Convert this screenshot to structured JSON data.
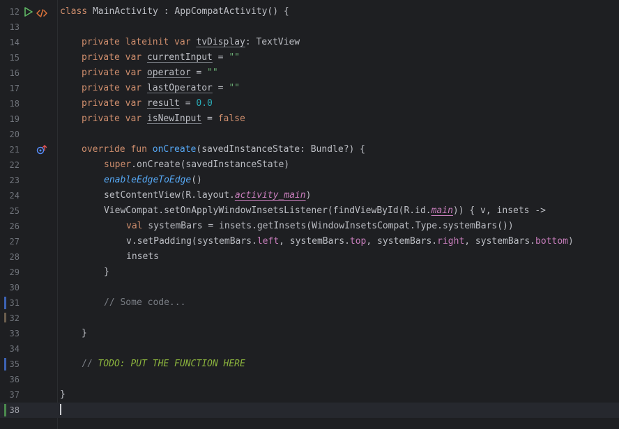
{
  "editor": {
    "language": "kotlin",
    "current_line": "38",
    "colors": {
      "background": "#1e1f22",
      "keyword": "#cf8e6d",
      "string": "#6aab73",
      "number": "#2aacb8",
      "function": "#56a8f5",
      "property": "#c77dbb",
      "comment": "#7a7e85",
      "todo": "#8bb33d",
      "change_marker_modified": "#3d63b4",
      "change_marker_added": "#4b8a4e"
    },
    "gutter_icons": {
      "line_12": [
        "run-icon",
        "code-icon"
      ],
      "line_21": [
        "override-icon"
      ]
    },
    "lines": [
      {
        "num": "12",
        "t": {
          "a": "class",
          "b": " MainActivity : AppCompatActivity() {"
        }
      },
      {
        "num": "13"
      },
      {
        "num": "14",
        "t": {
          "a": "private lateinit var",
          "b": "tvDisplay",
          "c": ": TextView"
        }
      },
      {
        "num": "15",
        "t": {
          "a": "private var",
          "b": "currentInput",
          "c": " = ",
          "d": "\"\""
        }
      },
      {
        "num": "16",
        "t": {
          "a": "private var",
          "b": "operator",
          "c": " = ",
          "d": "\"\""
        }
      },
      {
        "num": "17",
        "t": {
          "a": "private var",
          "b": "lastOperator",
          "c": " = ",
          "d": "\"\""
        }
      },
      {
        "num": "18",
        "t": {
          "a": "private var",
          "b": "result",
          "c": " = ",
          "d": "0.0"
        }
      },
      {
        "num": "19",
        "t": {
          "a": "private var",
          "b": "isNewInput",
          "c": " = ",
          "d": "false"
        }
      },
      {
        "num": "20"
      },
      {
        "num": "21",
        "t": {
          "a": "override fun",
          "b": "onCreate",
          "c": "(savedInstanceState: Bundle?) {"
        }
      },
      {
        "num": "22",
        "t": {
          "a": "super",
          "b": ".onCreate(savedInstanceState)"
        }
      },
      {
        "num": "23",
        "t": {
          "a": "enableEdgeToEdge",
          "b": "()"
        }
      },
      {
        "num": "24",
        "t": {
          "a": "setContentView(R.layout.",
          "b": "activity_main",
          "c": ")"
        }
      },
      {
        "num": "25",
        "t": {
          "a": "ViewCompat.setOnApplyWindowInsetsListener(findViewById(R.id.",
          "b": "main",
          "c": ")) { v, insets ->"
        }
      },
      {
        "num": "26",
        "t": {
          "a": "val",
          "b": " systemBars = insets.getInsets(WindowInsetsCompat.Type.systemBars())"
        }
      },
      {
        "num": "27",
        "t": {
          "a": "v.setPadding(systemBars.",
          "b": "left",
          "c": ", systemBars.",
          "d": "top",
          "e": ", systemBars.",
          "f": "right",
          "g": ", systemBars.",
          "h": "bottom",
          "i": ")"
        }
      },
      {
        "num": "28",
        "t": {
          "a": "insets"
        }
      },
      {
        "num": "29",
        "t": {
          "a": "}"
        }
      },
      {
        "num": "30"
      },
      {
        "num": "31",
        "t": {
          "a": "// Some code..."
        }
      },
      {
        "num": "32"
      },
      {
        "num": "33",
        "t": {
          "a": "}"
        }
      },
      {
        "num": "34"
      },
      {
        "num": "35",
        "t": {
          "a": "// ",
          "b": "TODO: PUT THE FUNCTION HERE"
        }
      },
      {
        "num": "36"
      },
      {
        "num": "37",
        "t": {
          "a": "}"
        }
      },
      {
        "num": "38"
      }
    ]
  }
}
